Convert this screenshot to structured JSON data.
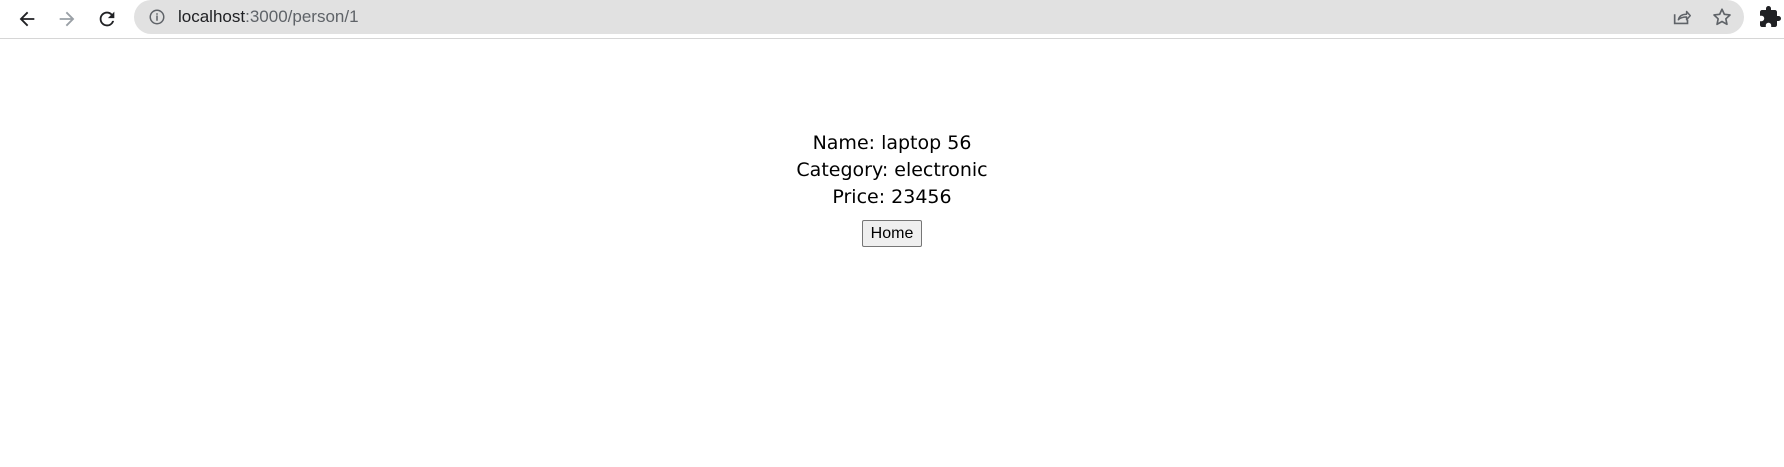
{
  "browser": {
    "url_host": "localhost",
    "url_path": ":3000/person/1",
    "icons": {
      "back": "back-arrow-icon",
      "forward": "forward-arrow-icon",
      "reload": "reload-icon",
      "site_info": "info-icon",
      "share": "share-icon",
      "bookmark": "star-icon",
      "extensions": "puzzle-icon"
    }
  },
  "detail": {
    "name_line": "Name: laptop 56",
    "category_line": "Category: electronic",
    "price_line": "Price: 23456",
    "home_button_label": "Home"
  }
}
